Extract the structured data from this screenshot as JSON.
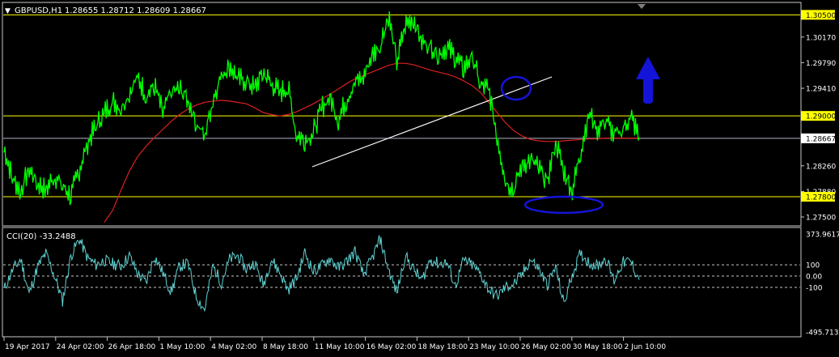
{
  "header": {
    "menu_glyph": "▼",
    "symbol": "GBPUSD,H1",
    "ohlc": "1.28655 1.28712 1.28609 1.28667"
  },
  "cci_panel": {
    "label": "CCI(20) -33.2488"
  },
  "colors": {
    "background": "#000000",
    "price_line": "#00ff00",
    "moving_average": "#dd1f1f",
    "trendline": "#ffffff",
    "horizontal_levels": "#ffff00",
    "current_price_line": "#b4b4c8",
    "cci_line": "#5fd3d3",
    "annotation_blue": "#1414d8",
    "level_tag": "#ffff00"
  },
  "icons": {
    "up_arrow": "blue-up-arrow-icon",
    "ellipse": "blue-ellipse-icon"
  },
  "chart_data": [
    {
      "type": "line",
      "title": "GBPUSD,H1",
      "ylim": [
        1.2738,
        1.3066
      ],
      "y_ticks": [
        "1.30500",
        "1.30170",
        "1.29790",
        "1.29410",
        "1.29000",
        "1.28667",
        "1.28260",
        "1.27880",
        "1.27800",
        "1.27500"
      ],
      "x_tick_labels": [
        "19 Apr 2017",
        "24 Apr 02:00",
        "26 Apr 18:00",
        "1 May 10:00",
        "4 May 02:00",
        "8 May 18:00",
        "11 May 10:00",
        "16 May 02:00",
        "18 May 18:00",
        "23 May 10:00",
        "26 May 02:00",
        "30 May 18:00",
        "2 Jun 10:00"
      ],
      "highlighted_levels": [
        1.305,
        1.29,
        1.278
      ],
      "current_price": 1.28667,
      "series": [
        {
          "values": [
            1.2852,
            1.2808,
            1.2788,
            1.2822,
            1.28,
            1.279,
            1.2812,
            1.2796,
            1.2782,
            1.282,
            1.286,
            1.2885,
            1.2905,
            1.2922,
            1.2912,
            1.2935,
            1.2958,
            1.293,
            1.2945,
            1.2905,
            1.2935,
            1.294,
            1.2925,
            1.289,
            1.287,
            1.2925,
            1.2962,
            1.2975,
            1.2955,
            1.2952,
            1.2942,
            1.2965,
            1.2948,
            1.2935,
            1.2942,
            1.2872,
            1.2865,
            1.2875,
            1.2912,
            1.2928,
            1.2895,
            1.2925,
            1.295,
            1.2958,
            1.299,
            1.3005,
            1.305,
            1.298,
            1.3035,
            1.3045,
            1.301,
            1.3005,
            1.2992,
            1.3002,
            1.2988,
            1.297,
            1.299,
            1.2945,
            1.294,
            1.287,
            1.2805,
            1.279,
            1.2828,
            1.2835,
            1.2822,
            1.2802,
            1.2862,
            1.2818,
            1.279,
            1.2848,
            1.2905,
            1.288,
            1.2895,
            1.287,
            1.288,
            1.29,
            1.2868
          ]
        },
        {
          "values": [
            null,
            null,
            null,
            null,
            null,
            null,
            null,
            null,
            null,
            null,
            null,
            null,
            1.2742,
            1.276,
            1.279,
            1.2818,
            1.284,
            1.2855,
            1.2868,
            1.288,
            1.2892,
            1.2902,
            1.291,
            1.2916,
            1.292,
            1.2922,
            1.2923,
            1.2922,
            1.292,
            1.2918,
            1.2912,
            1.2905,
            1.2902,
            1.29,
            1.2902,
            1.2906,
            1.2912,
            1.2918,
            1.2925,
            1.2932,
            1.294,
            1.2948,
            1.2955,
            1.296,
            1.2965,
            1.297,
            1.2975,
            1.2978,
            1.2978,
            1.2976,
            1.2972,
            1.2968,
            1.2965,
            1.2962,
            1.2958,
            1.2952,
            1.2945,
            1.2935,
            1.292,
            1.2905,
            1.289,
            1.2878,
            1.287,
            1.2865,
            1.2863,
            1.2862,
            1.2862,
            1.2863,
            1.2864,
            1.2865,
            1.2866,
            1.2866,
            1.2867,
            1.2867,
            1.2867,
            1.2867,
            1.2867
          ]
        }
      ]
    },
    {
      "type": "line",
      "title": "CCI(20) -33.2488",
      "ylim": [
        -495.7138,
        373.9617
      ],
      "y_ticks": [
        "373.9617",
        "100",
        "0.00",
        "-100",
        "-495.7138"
      ],
      "reference_levels": [
        100,
        0,
        -100
      ],
      "series": [
        {
          "values": [
            -120,
            50,
            150,
            -160,
            80,
            200,
            10,
            -220,
            180,
            330,
            160,
            100,
            140,
            110,
            90,
            180,
            20,
            -60,
            180,
            30,
            -140,
            90,
            110,
            -180,
            -300,
            90,
            -60,
            150,
            180,
            60,
            120,
            -80,
            150,
            30,
            -120,
            -20,
            210,
            40,
            90,
            160,
            70,
            130,
            220,
            10,
            150,
            330,
            60,
            -150,
            180,
            60,
            -40,
            150,
            110,
            120,
            -90,
            140,
            100,
            20,
            -120,
            -180,
            -100,
            -70,
            10,
            150,
            60,
            -80,
            80,
            -250,
            20,
            200,
            120,
            90,
            160,
            -40,
            120,
            130,
            -33
          ]
        }
      ]
    }
  ]
}
